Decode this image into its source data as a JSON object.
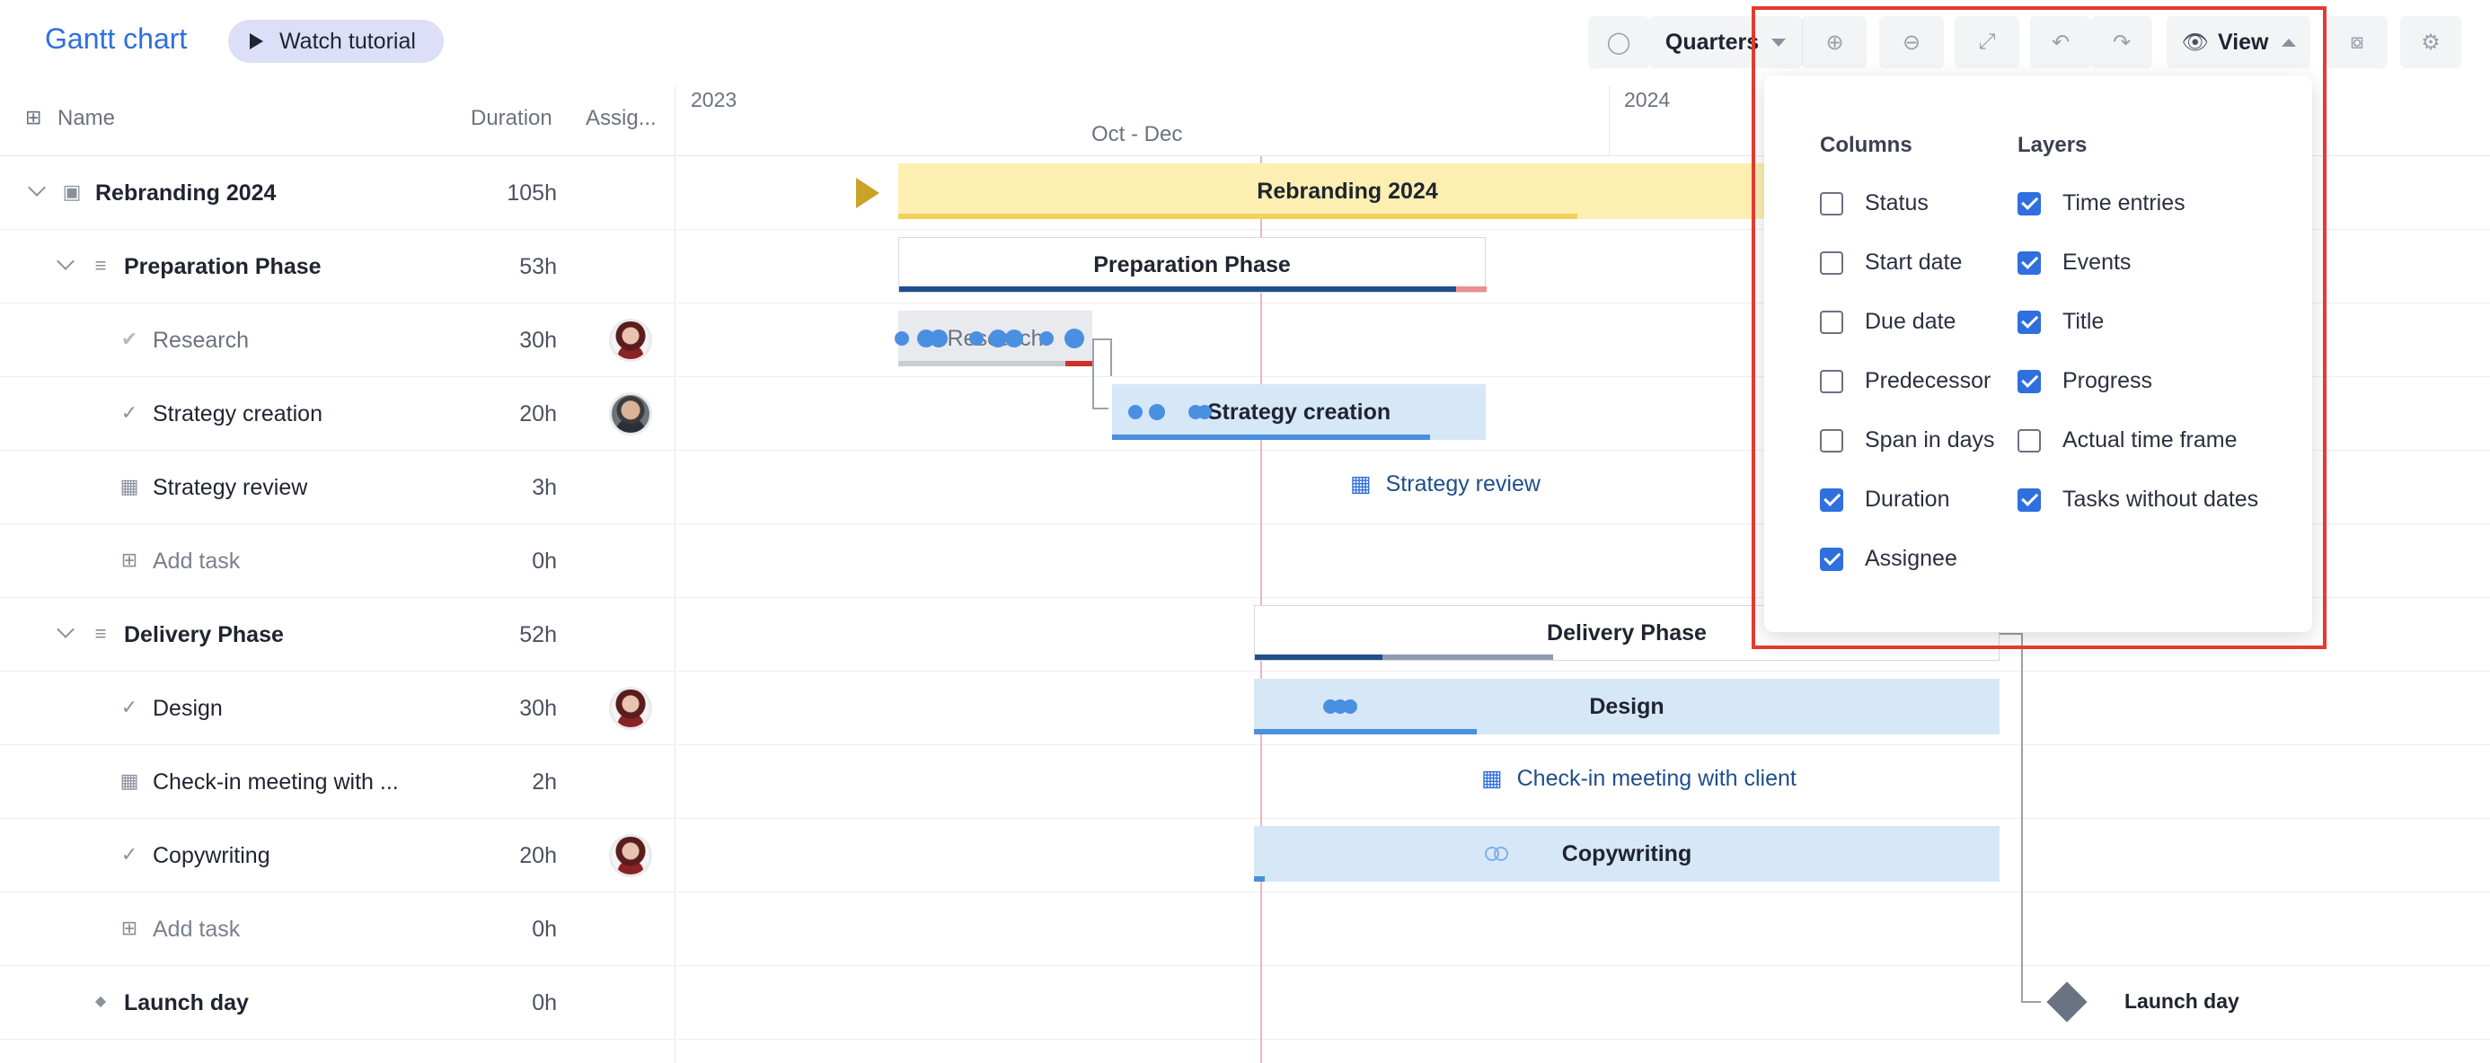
{
  "app": {
    "title": "Gantt chart",
    "tutorial_label": "Watch tutorial"
  },
  "toolbar": {
    "zoom_label": "Quarters",
    "view_label": "View"
  },
  "table": {
    "headers": {
      "name": "Name",
      "duration": "Duration",
      "assignee": "Assig..."
    },
    "rows": [
      {
        "name": "Rebranding 2024",
        "duration": "105h"
      },
      {
        "name": "Preparation Phase",
        "duration": "53h"
      },
      {
        "name": "Research",
        "duration": "30h"
      },
      {
        "name": "Strategy creation",
        "duration": "20h"
      },
      {
        "name": "Strategy review",
        "duration": "3h"
      },
      {
        "name": "Add task",
        "duration": "0h"
      },
      {
        "name": "Delivery Phase",
        "duration": "52h"
      },
      {
        "name": "Design",
        "duration": "30h"
      },
      {
        "name": "Check-in meeting with ...",
        "duration": "2h"
      },
      {
        "name": "Copywriting",
        "duration": "20h"
      },
      {
        "name": "Add task",
        "duration": "0h"
      },
      {
        "name": "Launch day",
        "duration": "0h"
      }
    ]
  },
  "timeline": {
    "year_2023": "2023",
    "year_2024": "2024",
    "quarter_label": "Oct - Dec",
    "bars": {
      "rebranding": "Rebranding 2024",
      "preparation": "Preparation Phase",
      "research": "Research",
      "strategy_creation": "Strategy creation",
      "strategy_review": "Strategy review",
      "delivery": "Delivery Phase",
      "design": "Design",
      "checkin": "Check-in meeting with client",
      "copywriting": "Copywriting",
      "launch": "Launch day"
    }
  },
  "view_panel": {
    "columns_title": "Columns",
    "layers_title": "Layers",
    "columns": [
      {
        "label": "Status",
        "checked": false
      },
      {
        "label": "Start date",
        "checked": false
      },
      {
        "label": "Due date",
        "checked": false
      },
      {
        "label": "Predecessor",
        "checked": false
      },
      {
        "label": "Span in days",
        "checked": false
      },
      {
        "label": "Duration",
        "checked": true
      },
      {
        "label": "Assignee",
        "checked": true
      }
    ],
    "layers": [
      {
        "label": "Time entries",
        "checked": true
      },
      {
        "label": "Events",
        "checked": true
      },
      {
        "label": "Title",
        "checked": true
      },
      {
        "label": "Progress",
        "checked": true
      },
      {
        "label": "Actual time frame",
        "checked": false
      },
      {
        "label": "Tasks without dates",
        "checked": true
      }
    ]
  },
  "colors": {
    "accent": "#2f6fde",
    "highlight": "#e53a2f"
  }
}
